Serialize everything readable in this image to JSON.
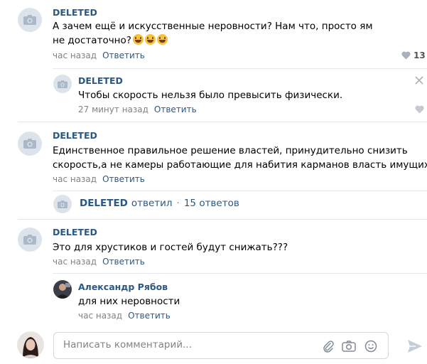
{
  "comments": [
    {
      "author": "DELETED",
      "text": "А зачем ещё и искусственные неровности? Нам что, просто ям не достаточно?",
      "time": "час назад",
      "reply_label": "Ответить",
      "likes": "13",
      "emoji": [
        "grinning-face-emoji",
        "grinning-face-emoji",
        "grinning-face-emoji"
      ]
    },
    {
      "author": "DELETED",
      "text": "Чтобы скорость нельзя было превысить физически.",
      "time": "27 минут назад",
      "reply_label": "Ответить"
    },
    {
      "author": "DELETED",
      "text_line1": "Единственное правильное решение властей, принудительно снизить",
      "text_line2": "скорость,а не камеры работающие для набития карманов власть имущих",
      "time": "час назад",
      "reply_label": "Ответить"
    },
    {
      "thread": {
        "author": "DELETED",
        "verb": "ответил",
        "separator": "·",
        "replies": "15 ответов"
      }
    },
    {
      "author": "DELETED",
      "text": "Это для хрустиков и гостей будут снижать???",
      "time": "час назад",
      "reply_label": "Ответить"
    },
    {
      "author": "Александр Рябов",
      "text": "для них неровности",
      "time": "час назад",
      "reply_label": "Ответить"
    }
  ],
  "composer": {
    "placeholder": "Написать комментарий...",
    "icons": [
      "paperclip-icon",
      "camera-icon",
      "smiley-icon"
    ],
    "send_icon": "send-arrow-icon"
  },
  "colors": {
    "link": "#2a5885",
    "meta": "#828282",
    "divider": "#e7e8ec",
    "deleted_avatar_bg": "#dde3ea"
  }
}
